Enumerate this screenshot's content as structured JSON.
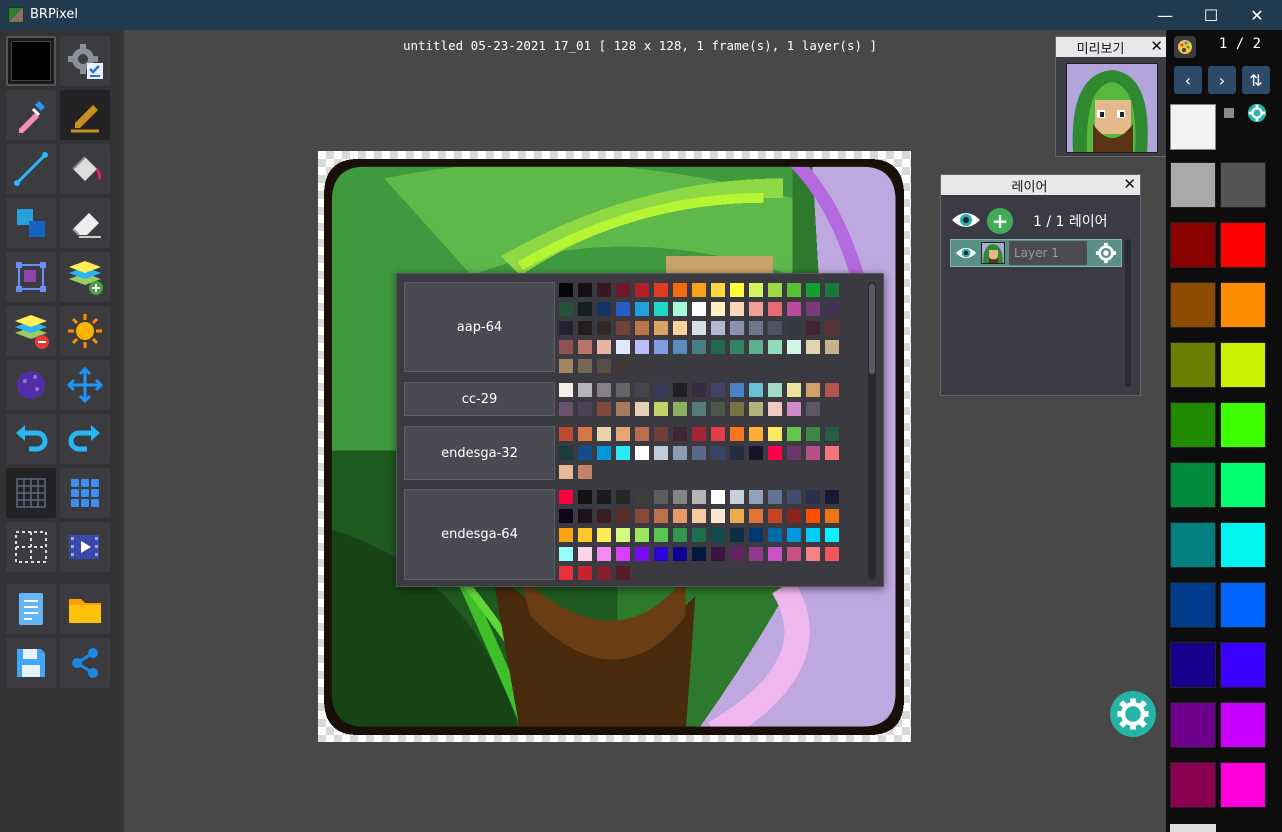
{
  "window": {
    "app_title": "BRPixel",
    "minimize": "—",
    "maximize": "☐",
    "close": "✕"
  },
  "document": {
    "title": "untitled 05-23-2021 17_01  [ 128 x 128, 1 frame(s), 1 layer(s) ]"
  },
  "toolbar": {
    "tools": [
      "current-color",
      "settings",
      "eyedropper",
      "pen",
      "line",
      "bucket",
      "copy-selection",
      "eraser",
      "transform",
      "add-layer",
      "delete-layer",
      "brightness",
      "color-wheel",
      "move",
      "undo",
      "redo",
      "grid",
      "tile-view",
      "selection-grid",
      "animation",
      "notes",
      "open-folder",
      "save",
      "share"
    ]
  },
  "palette_popup": {
    "palettes": [
      {
        "name": "aap-64",
        "colors": [
          "#060608",
          "#141013",
          "#3b1725",
          "#73172d",
          "#b4202a",
          "#df3e23",
          "#fa6a0a",
          "#f9a31b",
          "#ffd541",
          "#fffc40",
          "#d6f264",
          "#9cdb43",
          "#59c135",
          "#14a02e",
          "#1a7a3e",
          "#24523b",
          "#122020",
          "#143464",
          "#285cc4",
          "#249fde",
          "#20d6c7",
          "#a6fcdb",
          "#ffffff",
          "#fef3c0",
          "#fad6b8",
          "#f5a097",
          "#e86a73",
          "#bc4a9b",
          "#793a80",
          "#403353",
          "#242234",
          "#221c1a",
          "#322b28",
          "#71413b",
          "#bb7547",
          "#dba463",
          "#f4d29c",
          "#dae0ea",
          "#b3b9d1",
          "#8b93af",
          "#6d758d",
          "#4a5462",
          "#333941",
          "#422433",
          "#5b3138",
          "#8e5252",
          "#ba756a",
          "#e9b5a3",
          "#e3e6ff",
          "#b9bffb",
          "#849be4",
          "#588dbe",
          "#477d85",
          "#23674e",
          "#328464",
          "#5daf8d",
          "#92dcba",
          "#cdf7e2",
          "#e4d2aa",
          "#c7b08b",
          "#a08662",
          "#796755",
          "#5a4e44",
          "#423934"
        ]
      },
      {
        "name": "cc-29",
        "colors": [
          "#f2f0e5",
          "#b8b5b9",
          "#868188",
          "#646365",
          "#45444f",
          "#3a3858",
          "#212123",
          "#352b42",
          "#43436a",
          "#4b80ca",
          "#68c2d3",
          "#a2dcc7",
          "#ede19e",
          "#d3a068",
          "#b45252",
          "#6a536e",
          "#4b4158",
          "#80493a",
          "#a77b5b",
          "#e5ceb4",
          "#c2d368",
          "#8ab060",
          "#567b79",
          "#4e584a",
          "#7b7243",
          "#b2b47e",
          "#edc8c4",
          "#cf8acb",
          "#5f556a"
        ]
      },
      {
        "name": "endesga-32",
        "colors": [
          "#be4a2f",
          "#d77643",
          "#ead4aa",
          "#e4a672",
          "#b86f50",
          "#733e39",
          "#3e2731",
          "#a22633",
          "#e43b44",
          "#f77622",
          "#feae34",
          "#fee761",
          "#63c74d",
          "#3e8948",
          "#265c42",
          "#193c3e",
          "#124e89",
          "#0099db",
          "#2ce8f5",
          "#ffffff",
          "#c0cbdc",
          "#8b9bb4",
          "#5a6988",
          "#3a4466",
          "#262b44",
          "#181425",
          "#ff0044",
          "#68386c",
          "#b55088",
          "#f6757a",
          "#e8b796",
          "#c28569"
        ]
      },
      {
        "name": "endesga-64",
        "colors": [
          "#ff0040",
          "#131313",
          "#1b1b1b",
          "#272727",
          "#3d3d3d",
          "#5d5d5d",
          "#858585",
          "#b4b4b4",
          "#ffffff",
          "#c7cfdd",
          "#92a1b9",
          "#657392",
          "#424c6e",
          "#2a2f4e",
          "#1a1932",
          "#0e071b",
          "#1c121c",
          "#391f21",
          "#5d2c28",
          "#8a4836",
          "#bf6f4a",
          "#e69c69",
          "#f6ca9f",
          "#f9e6cf",
          "#edab50",
          "#e07438",
          "#c64524",
          "#8e251d",
          "#ff5000",
          "#ed7614",
          "#ffa214",
          "#ffc825",
          "#ffeb57",
          "#d3fc7e",
          "#99e65f",
          "#5ac54f",
          "#33984b",
          "#1e6f50",
          "#134c4c",
          "#0c2e44",
          "#00396d",
          "#0069aa",
          "#0098dc",
          "#00cdf9",
          "#0cf1ff",
          "#94fdff",
          "#fdd2ed",
          "#f389f5",
          "#db3ffd",
          "#7a09fa",
          "#3003d9",
          "#0c0293",
          "#03193f",
          "#3b1443",
          "#622461",
          "#93388f",
          "#ca52c9",
          "#c85086",
          "#f68187",
          "#f5555d",
          "#ea323c",
          "#c42430",
          "#891e2b",
          "#571c27"
        ]
      }
    ]
  },
  "preview_panel": {
    "title": "미리보기",
    "close": "✕"
  },
  "layers_panel": {
    "title": "레이어",
    "close": "✕",
    "count": "1 / 1 레이어",
    "layers": [
      {
        "placeholder": "Layer 1"
      }
    ]
  },
  "color_panel": {
    "page": "1 / 2",
    "prev": "‹",
    "next": "›",
    "swap": "⇅",
    "foreground": "#f4f4f4",
    "colors": [
      [
        "#a9a9a9",
        "#555555"
      ],
      [
        "#8b0000",
        "#ff0000"
      ],
      [
        "#8b4b00",
        "#ff8c00"
      ],
      [
        "#6b7f00",
        "#c8f000"
      ],
      [
        "#1e8b00",
        "#3cff00"
      ],
      [
        "#008b3c",
        "#00ff6e"
      ],
      [
        "#008080",
        "#00f5f0"
      ],
      [
        "#003c8b",
        "#0064ff"
      ],
      [
        "#16008b",
        "#3c00ff"
      ],
      [
        "#6e008b",
        "#c800ff"
      ],
      [
        "#8b0050",
        "#ff00dc"
      ]
    ]
  },
  "theme": {
    "accent": "#27b4a8",
    "panel": "#3b3a45",
    "titlebar": "#213a4d"
  }
}
